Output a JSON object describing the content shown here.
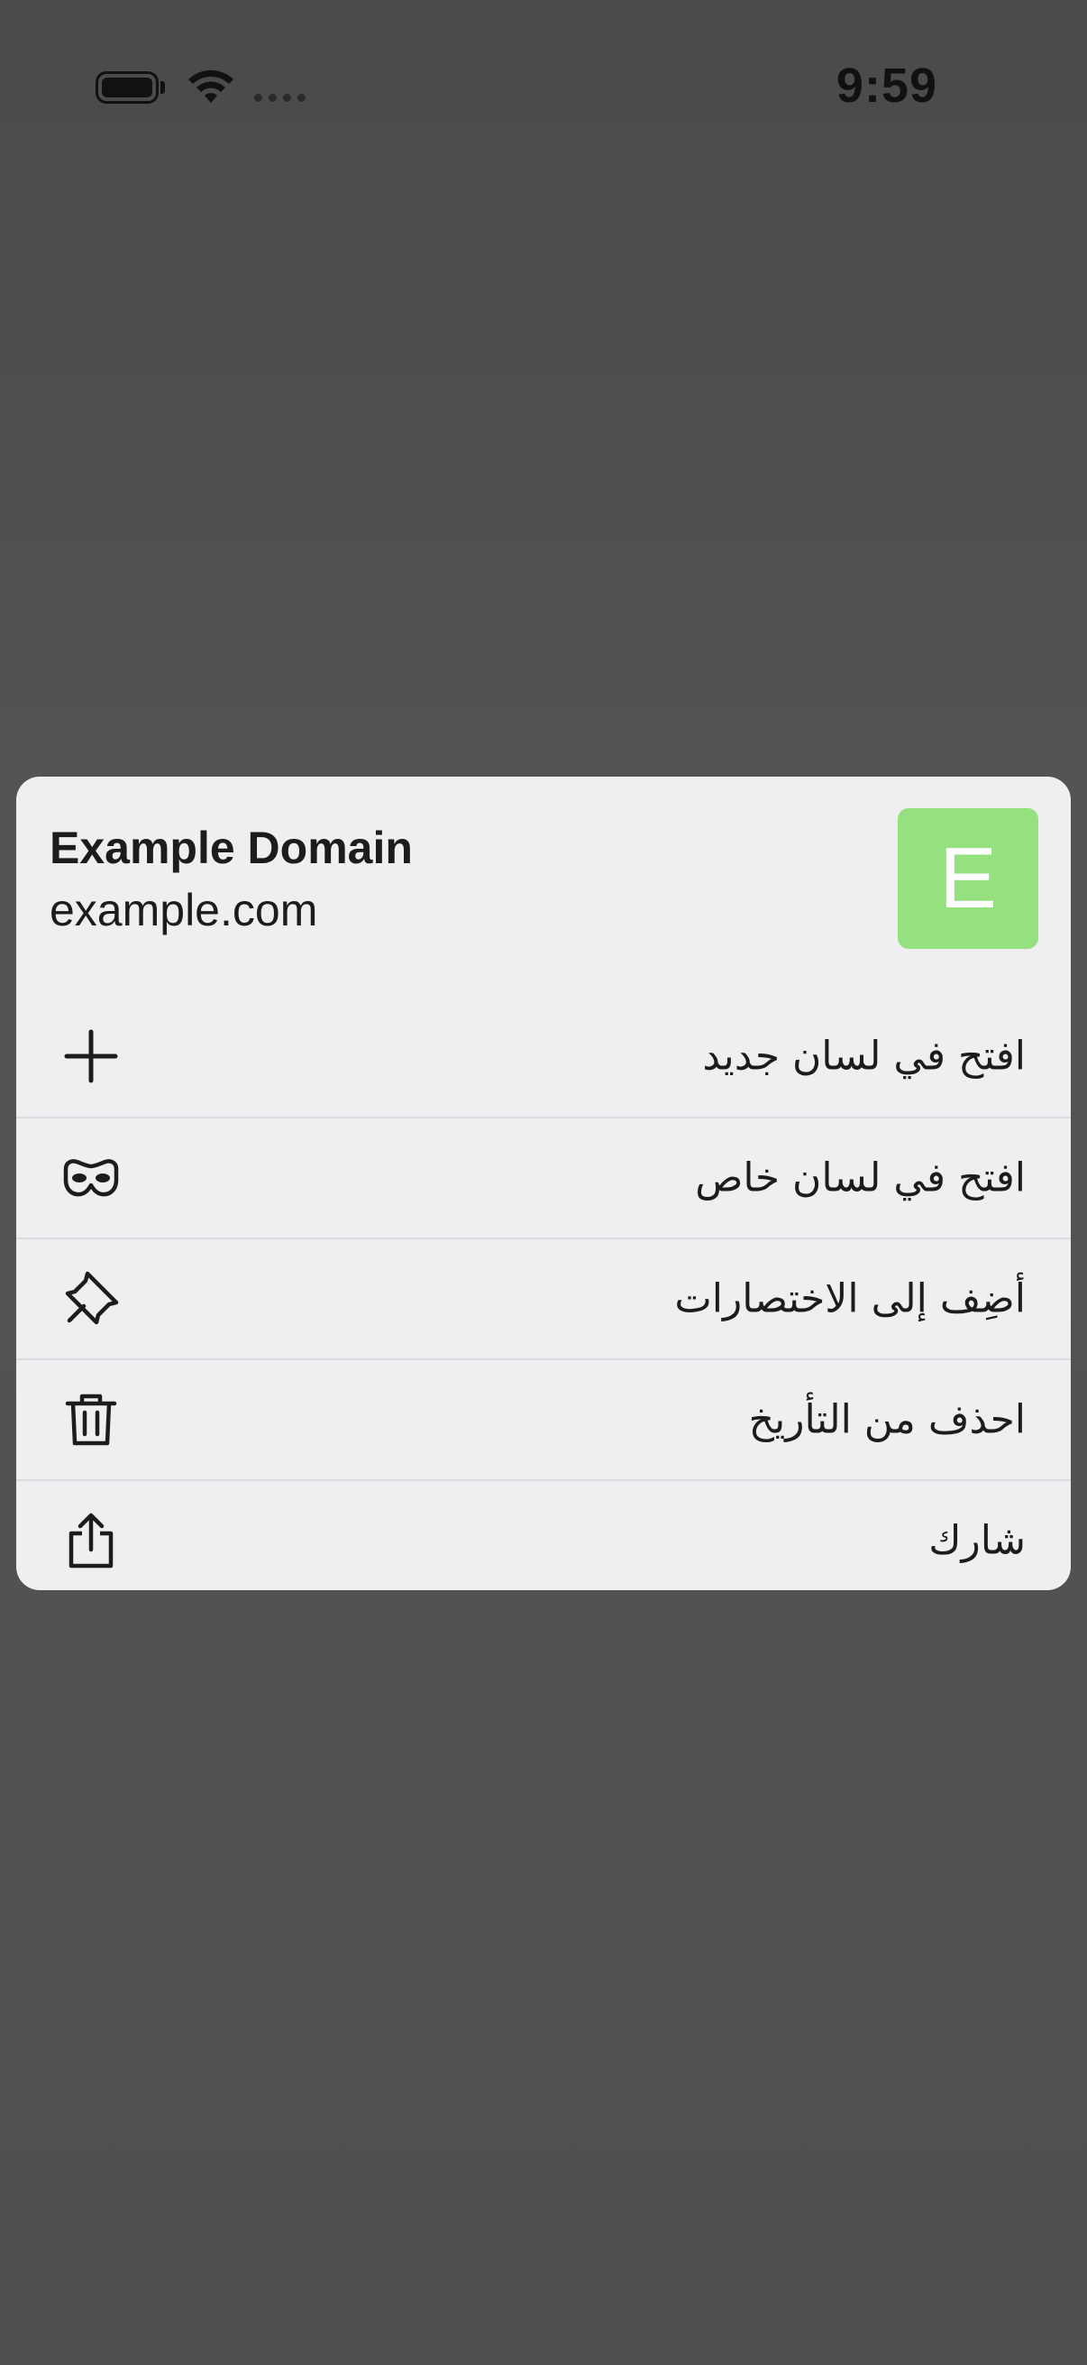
{
  "status_bar": {
    "time": "9:59",
    "icons": [
      "battery-icon",
      "wifi-icon",
      "cellular-signal-icon"
    ]
  },
  "context_menu": {
    "site_title": "Example Domain",
    "site_url": "example.com",
    "favicon_letter": "E",
    "favicon_color": "#95e07f",
    "items": [
      {
        "label": "افتح في لسان جديد",
        "icon": "plus-icon"
      },
      {
        "label": "افتح في لسان خاص",
        "icon": "private-mask-icon"
      },
      {
        "label": "أضِف إلى الاختصارات",
        "icon": "pin-icon"
      },
      {
        "label": "احذف من التأريخ",
        "icon": "trash-icon"
      },
      {
        "label": "شارك",
        "icon": "share-icon"
      }
    ]
  }
}
